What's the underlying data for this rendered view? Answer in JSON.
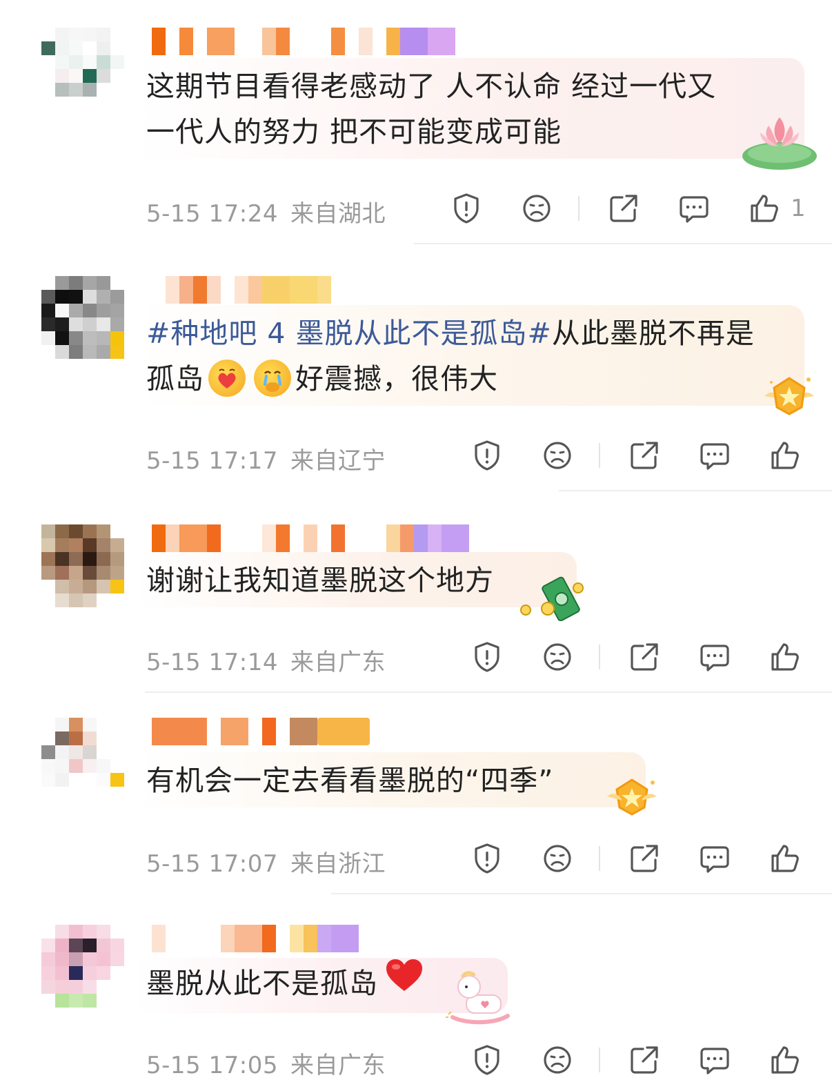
{
  "comments": [
    {
      "text_lines": [
        "这期节目看得老感动了 人不认命 经过一代又",
        "一代人的努力 把不可能变成可能"
      ],
      "time": "5-15 17:24",
      "location": "来自湖北",
      "like_count": "1",
      "decoration": "lotus"
    },
    {
      "hashtag": "#种地吧 4 墨脱从此不是孤岛#",
      "text_line1_rest": "从此墨脱不再是",
      "text_line2_start": "孤岛",
      "text_line2_end": "好震撼，很伟大",
      "time": "5-15 17:17",
      "location": "来自辽宁",
      "like_count": "",
      "decoration": "gold-badge"
    },
    {
      "text": "谢谢让我知道墨脱这个地方",
      "time": "5-15 17:14",
      "location": "来自广东",
      "like_count": "",
      "decoration": "money"
    },
    {
      "text": "有机会一定去看看墨脱的“四季”",
      "time": "5-15 17:07",
      "location": "来自浙江",
      "like_count": "",
      "decoration": "gold-badge"
    },
    {
      "text": "墨脱从此不是孤岛",
      "time": "5-15 17:05",
      "location": "来自广东",
      "like_count": "",
      "decoration": "pony"
    }
  ],
  "icons": [
    "report-icon",
    "dislike-face-icon",
    "share-icon",
    "reply-icon",
    "thumbs-up-icon"
  ],
  "colors": {
    "text": "#222222",
    "meta": "#9a9a9a",
    "hashtag": "#3c5a99",
    "icon": "#555555",
    "divider": "#eeeeee"
  }
}
